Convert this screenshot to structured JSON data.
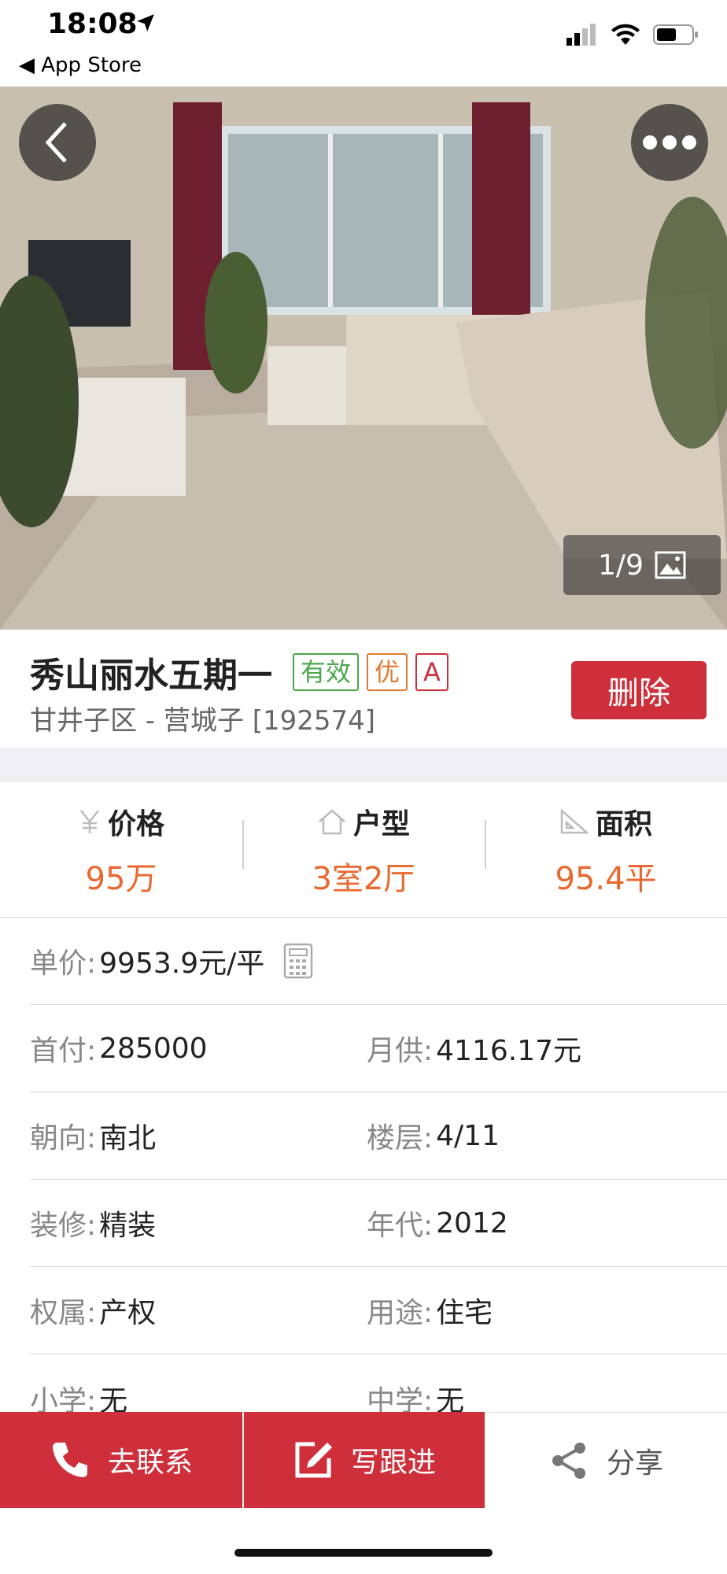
{
  "status_bar": {
    "time": "18:08",
    "back_app": "◀ App Store"
  },
  "gallery": {
    "counter": "1/9"
  },
  "listing": {
    "title": "秀山丽水五期一",
    "tags": [
      "有效",
      "优",
      "A"
    ],
    "location": "甘井子区 - 营城子 [192574]",
    "delete_label": "删除"
  },
  "stats": [
    {
      "label": "价格",
      "value": "95万",
      "icon": "yen-icon"
    },
    {
      "label": "户型",
      "value": "3室2厅",
      "icon": "house-icon"
    },
    {
      "label": "面积",
      "value": "95.4平",
      "icon": "ruler-icon"
    }
  ],
  "details": {
    "unit_price_label": "单价:",
    "unit_price_value": "9953.9元/平",
    "rows": [
      [
        {
          "label": "首付:",
          "value": "285000"
        },
        {
          "label": "月供:",
          "value": "4116.17元"
        }
      ],
      [
        {
          "label": "朝向:",
          "value": "南北"
        },
        {
          "label": "楼层:",
          "value": "4/11"
        }
      ],
      [
        {
          "label": "装修:",
          "value": "精装"
        },
        {
          "label": "年代:",
          "value": "2012"
        }
      ],
      [
        {
          "label": "权属:",
          "value": "产权"
        },
        {
          "label": "用途:",
          "value": "住宅"
        }
      ],
      [
        {
          "label": "小学:",
          "value": "无"
        },
        {
          "label": "中学:",
          "value": "无"
        }
      ]
    ]
  },
  "bottom_bar": {
    "contact_label": "去联系",
    "follow_label": "写跟进",
    "share_label": "分享"
  },
  "colors": {
    "accent_red": "#cf2f3b",
    "value_orange": "#e8692f",
    "tag_green": "#4aa84a"
  }
}
